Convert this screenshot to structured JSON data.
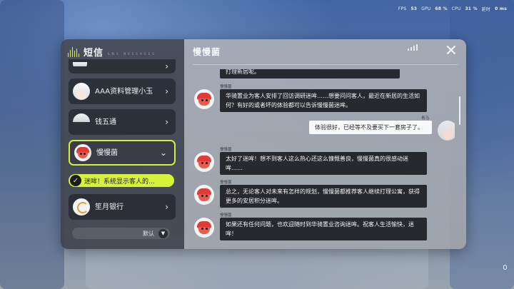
{
  "hud": {
    "fps_label": "FPS",
    "fps_value": "53",
    "gpu_label": "GPU",
    "gpu_value": "68 %",
    "cpu_label": "CPU",
    "cpu_value": "31 %",
    "time_label": "延时",
    "time_value": "0 ms"
  },
  "app": {
    "title": "短信",
    "subtitle": "SMS MESSAGES",
    "accent_color": "#d7f23a"
  },
  "contacts": [
    {
      "name": "",
      "sub": "",
      "icon": "avatar-icon"
    },
    {
      "name": "AAA资料管理小玉",
      "sub": "",
      "icon": "avatar-icon"
    },
    {
      "name": "钱五通",
      "sub": "",
      "icon": "avatar-icon"
    },
    {
      "name": "慢慢菌",
      "sub": "",
      "icon": "avatar-icon",
      "active": true
    },
    {
      "name": "笙月银行",
      "sub": "",
      "icon": "bank-icon"
    }
  ],
  "notice": {
    "text": "迷哞！系统显示客人的…"
  },
  "filter": {
    "label": "默认"
  },
  "chat": {
    "title": "慢慢菌",
    "messages": [
      {
        "sender": "",
        "text": "打理新居呢。",
        "side": "left"
      },
      {
        "sender": "慢慢菌",
        "text": "华骑置业为客人安排了回访调研迷哞……想要问问客人，最近在新居的生活如何？有好的或者坏的体验都可以告诉慢慢菌迷哞。",
        "side": "left"
      },
      {
        "sender": "青马",
        "text": "体验很好，已经等不及要买下一套房子了。",
        "side": "right"
      },
      {
        "sender": "慢慢菌",
        "text": "太好了迷哞！想不到客人这么热心还这么慷慨善良，慢慢菌真的很感动迷哞……",
        "side": "left"
      },
      {
        "sender": "慢慢菌",
        "text": "总之，无论客人对未来有怎样的规划，慢慢菌都推荐客人继续打理公寓，获得更多的安居积分迷哞。",
        "side": "left"
      },
      {
        "sender": "慢慢菌",
        "text": "如果还有任何问题，也欢迎随时到华骑置业咨询迷哞。祝客人生活愉快，迷哞！",
        "side": "left"
      }
    ]
  }
}
